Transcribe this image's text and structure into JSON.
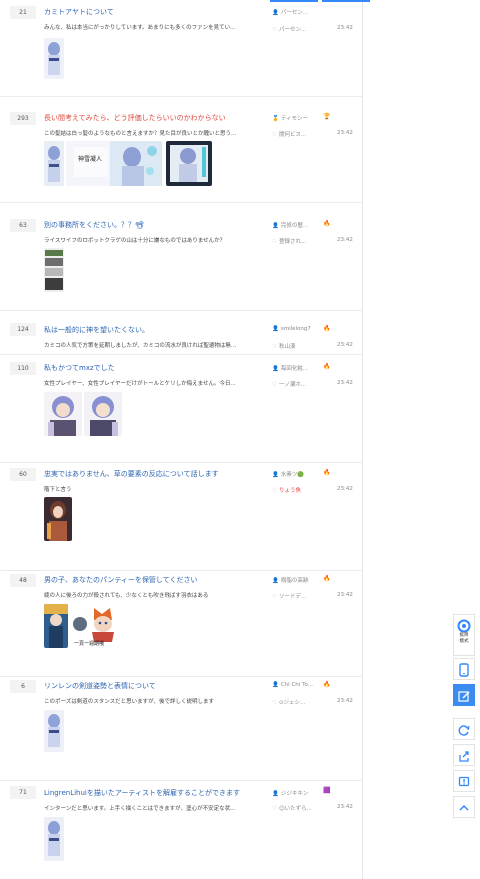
{
  "threads": [
    {
      "count": "21",
      "title": "カミトアヤトについて",
      "hot": false,
      "desc": "みんな、私は本当にがっかりしています。あまりにも多くのファンを見てい...",
      "author": "パーセン...",
      "last_reply": "パーセン...",
      "time": "23:42",
      "badge": ""
    },
    {
      "count": "293",
      "title": "長い間考えてみたら、どう評価したらいいのかわからない",
      "hot": true,
      "desc": "この髪結は白っ髪のようなものと言えますか？見た目が良いとか醜いと思う...",
      "author": "ティモシー",
      "last_reply": "闇何ビス...",
      "time": "23:42",
      "badge": "🏆"
    },
    {
      "count": "63",
      "title": "別の事務所をください。？？📽",
      "hot": false,
      "desc": "ライスワイフのロボットクラゲの山は十分に嫌なものではありませんか？",
      "author": "完修の歴...",
      "last_reply": "登録され...",
      "time": "23:42",
      "badge": "🔥"
    },
    {
      "count": "124",
      "title": "私は一般的に神を望いたくない。",
      "hot": false,
      "desc": "カミコの人気で方策を延期しましたが、カミコの流水が良ければ聖遺物は無...",
      "author": "smilelong7",
      "last_reply": "秋山湊",
      "time": "23:42",
      "badge": "🔥"
    },
    {
      "count": "110",
      "title": "私もかつてmxzでした",
      "hot": false,
      "desc": "女性プレイヤー、女性プレイヤーだけがトールとケリしか侮えません。今日...",
      "author": "毎回化粧...",
      "last_reply": "一ノ瀬ホ...",
      "time": "23:42",
      "badge": "🔥"
    },
    {
      "count": "60",
      "title": "忠実ではありません、草の要素の反応について話します",
      "hot": false,
      "desc": "階下と言う",
      "author": "水素ツ🟢",
      "last_reply": "りょう魚",
      "time": "23:42",
      "badge": "🔥"
    },
    {
      "count": "48",
      "title": "男の子、あなたのパンティーを保管してください",
      "hot": false,
      "desc": "綾の人に後ろの力が殺されても、少なくとも吹き飛ばす羽衣はある",
      "author": "樹脂の髙跡",
      "last_reply": "ソードデ...",
      "time": "23:42",
      "badge": "🔥"
    },
    {
      "count": "6",
      "title": "リンレンの剣道姿勢と表情について",
      "hot": false,
      "desc": "このポーズは剣道のスタンスだと思いますが、後で詳しく説明します",
      "author": "Chi Chi To...",
      "last_reply": "⊙ジェシ...",
      "time": "23:42",
      "badge": "🔥"
    },
    {
      "count": "71",
      "title": "LingrenLihuiを描いたアーティストを解雇することができます",
      "hot": false,
      "desc": "インターンだと思います。上手く描くことはできますが、塗心が不安定な状...",
      "author": "ジジキキン",
      "last_reply": "☺いたずら...",
      "time": "23:42",
      "badge": "🟪"
    }
  ],
  "thumb_text": {
    "t1": "神雪凝人",
    "t2": "一頁一週期哦"
  },
  "sidebar": {
    "view_mode_label_1": "极简",
    "view_mode_label_2": "模式"
  },
  "colors": {
    "accent": "#3388ff",
    "title_link": "#2d64b3",
    "hot_title": "#e0483b"
  }
}
